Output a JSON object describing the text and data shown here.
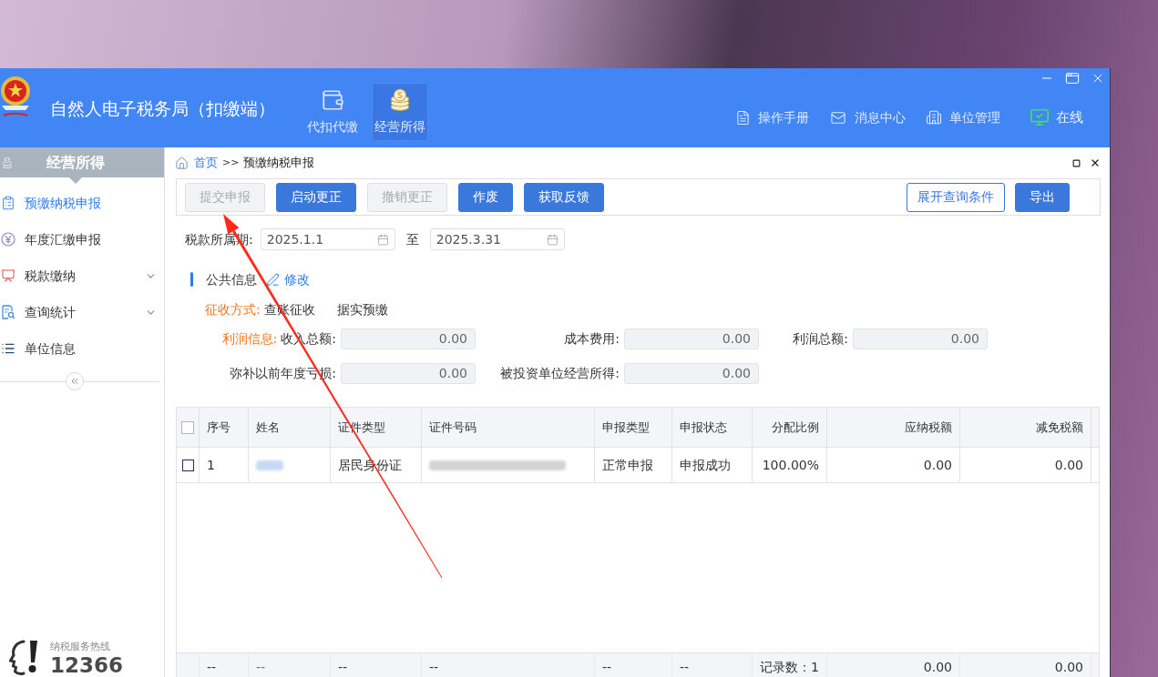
{
  "window": {
    "title": "自然人电子税务局（扣缴端）"
  },
  "nav_tabs": [
    {
      "label": "代扣代缴",
      "selected": false
    },
    {
      "label": "经营所得",
      "selected": true
    }
  ],
  "header_links": [
    {
      "label": "操作手册"
    },
    {
      "label": "消息中心"
    },
    {
      "label": "单位管理"
    }
  ],
  "status": {
    "label": "在线"
  },
  "sidebar": {
    "title": "经营所得",
    "items": [
      {
        "label": "预缴纳税申报",
        "kind": "page",
        "selected": true
      },
      {
        "label": "年度汇缴申报",
        "kind": "page",
        "selected": false
      },
      {
        "label": "税款缴纳",
        "kind": "group",
        "selected": false,
        "expanded": false
      },
      {
        "label": "查询统计",
        "kind": "group",
        "selected": false,
        "expanded": false
      },
      {
        "label": "单位信息",
        "kind": "page",
        "selected": false
      }
    ],
    "hotline": {
      "caption": "纳税服务热线",
      "number": "12366"
    }
  },
  "breadcrumb": {
    "home": "首页",
    "separator": ">>",
    "current": "预缴纳税申报"
  },
  "toolbar": {
    "left_buttons": [
      {
        "label": "提交申报",
        "kind": "primary",
        "disabled": true
      },
      {
        "label": "启动更正",
        "kind": "primary",
        "disabled": false
      },
      {
        "label": "撤销更正",
        "kind": "primary",
        "disabled": true
      },
      {
        "label": "作废",
        "kind": "primary",
        "disabled": false
      },
      {
        "label": "获取反馈",
        "kind": "primary",
        "disabled": false
      }
    ],
    "right_buttons": [
      {
        "label": "展开查询条件",
        "kind": "outline",
        "disabled": false
      },
      {
        "label": "导出",
        "kind": "primary",
        "disabled": false
      }
    ]
  },
  "period": {
    "label": "税款所属期:",
    "start": "2025.1.1",
    "separator": "至",
    "end": "2025.3.31"
  },
  "public_info": {
    "title": "公共信息",
    "edit": "修改",
    "collection": {
      "label": "征收方式:",
      "options": [
        "查账征收",
        "据实预缴"
      ]
    },
    "profit": {
      "label": "利润信息:",
      "rows": [
        {
          "fields": [
            {
              "label": "收入总额:",
              "value": "0.00"
            },
            {
              "label": "成本费用:",
              "value": "0.00"
            },
            {
              "label": "利润总额:",
              "value": "0.00"
            }
          ]
        },
        {
          "fields": [
            {
              "label": "弥补以前年度亏损:",
              "value": "0.00"
            },
            {
              "label": "被投资单位经营所得:",
              "value": "0.00"
            }
          ]
        }
      ]
    }
  },
  "table": {
    "select_all": {
      "checked": false
    },
    "columns": [
      "序号",
      "姓名",
      "证件类型",
      "证件号码",
      "申报类型",
      "申报状态",
      "分配比例",
      "应纳税额",
      "减免税额"
    ],
    "rows": [
      {
        "checked": false,
        "cells": [
          {
            "kind": "text",
            "text": "1"
          },
          {
            "kind": "redacted"
          },
          {
            "kind": "text",
            "text": "居民身份证"
          },
          {
            "kind": "redacted"
          },
          {
            "kind": "text",
            "text": "正常申报"
          },
          {
            "kind": "text",
            "text": "申报成功"
          },
          {
            "kind": "text",
            "text": "100.00%"
          },
          {
            "kind": "text",
            "text": "0.00"
          },
          {
            "kind": "text",
            "text": "0.00"
          }
        ]
      }
    ],
    "footer": [
      "--",
      "--",
      "--",
      "--",
      "--",
      "--",
      "记录数：1",
      "0.00",
      "0.00"
    ]
  }
}
